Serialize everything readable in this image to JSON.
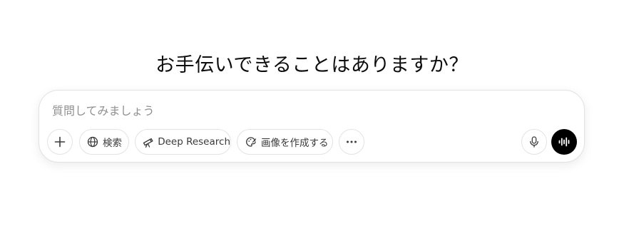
{
  "greeting": "お手伝いできることはありますか？",
  "composer": {
    "placeholder": "質問してみましょう",
    "value": ""
  },
  "toolbar": {
    "attach_icon": "plus-icon",
    "search": {
      "label": "検索",
      "icon": "globe-icon"
    },
    "deep_research": {
      "label": "Deep Research",
      "icon": "telescope-icon"
    },
    "create_image": {
      "label": "画像を作成する",
      "icon": "palette-icon"
    },
    "more_icon": "ellipsis-icon",
    "mic_icon": "microphone-icon",
    "voice_icon": "voice-waveform-icon",
    "voice_button_color": "#000000"
  }
}
